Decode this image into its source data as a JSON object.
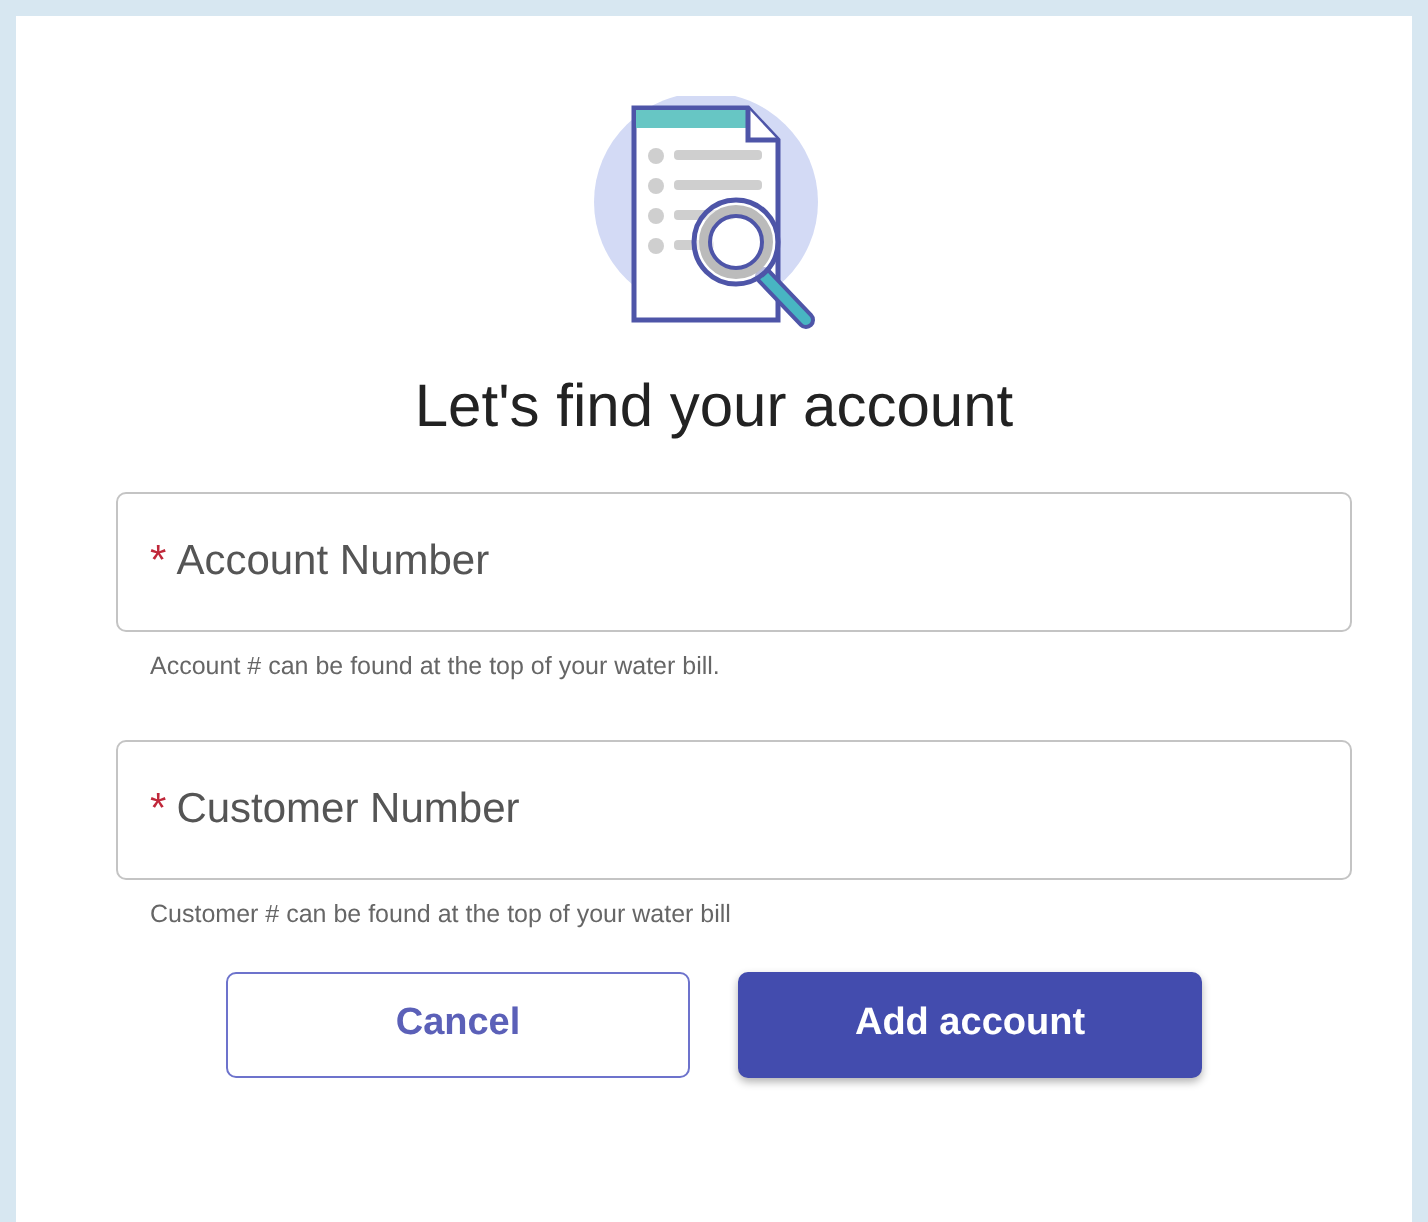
{
  "title": "Let's find your account",
  "fields": [
    {
      "required_mark": "*",
      "label": "Account Number",
      "hint": "Account # can be found at the top of your water bill."
    },
    {
      "required_mark": "*",
      "label": "Customer Number",
      "hint": "Customer # can be found at the top of your water bill"
    }
  ],
  "buttons": [
    {
      "label": "Cancel",
      "kind": "outline"
    },
    {
      "label": "Add account",
      "kind": "primary"
    }
  ]
}
